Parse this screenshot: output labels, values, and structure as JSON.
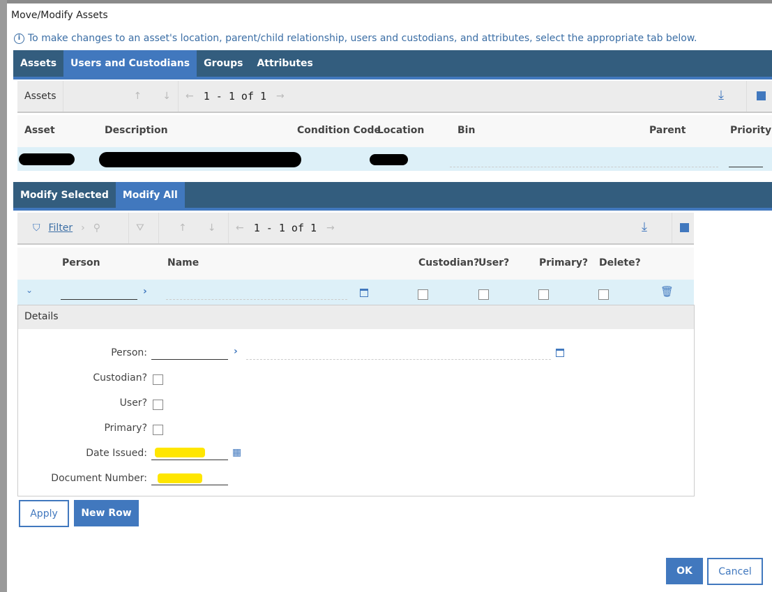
{
  "dialog": {
    "title": "Move/Modify Assets",
    "info": "To make changes to an asset's location, parent/child relationship, users and custodians, and attributes, select the appropriate tab below."
  },
  "tabs": [
    {
      "label": "Assets"
    },
    {
      "label": "Users and Custodians",
      "active": true
    },
    {
      "label": "Groups"
    },
    {
      "label": "Attributes"
    }
  ],
  "assets_table": {
    "title": "Assets",
    "pager": "1 - 1 of 1",
    "columns": [
      "Asset",
      "Description",
      "Condition Code",
      "Location",
      "Bin",
      "Parent",
      "Priority"
    ]
  },
  "subtabs": [
    {
      "label": "Modify Selected"
    },
    {
      "label": "Modify All",
      "active": true
    }
  ],
  "people_table": {
    "filter_label": "Filter",
    "pager": "1 - 1 of 1",
    "columns": [
      "Person",
      "Name",
      "Custodian?",
      "User?",
      "Primary?",
      "Delete?"
    ]
  },
  "details": {
    "title": "Details",
    "person_label": "Person:",
    "custodian_label": "Custodian?",
    "user_label": "User?",
    "primary_label": "Primary?",
    "date_issued_label": "Date Issued:",
    "document_number_label": "Document Number:"
  },
  "buttons": {
    "apply": "Apply",
    "new_row": "New Row",
    "ok": "OK",
    "cancel": "Cancel"
  },
  "colors": {
    "tabbar": "#335d7e",
    "accent": "#4178be",
    "row_selected": "#ddf0f8"
  }
}
